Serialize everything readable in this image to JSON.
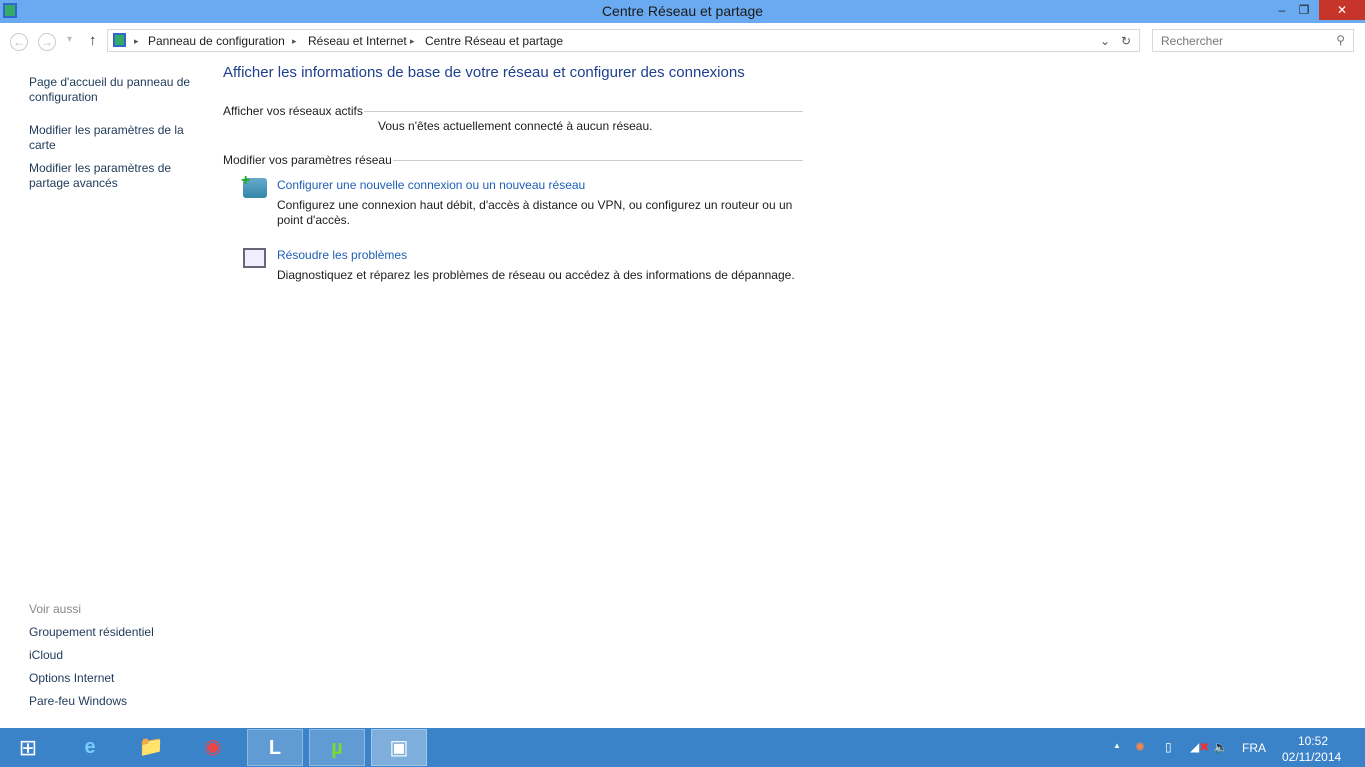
{
  "window": {
    "title": "Centre Réseau et partage",
    "min": "–",
    "restore": "❐",
    "close": "✕"
  },
  "nav": {
    "back": "←",
    "forward": "→",
    "recent": "▾",
    "up": "↑",
    "breadcrumb": [
      "Panneau de configuration",
      "Réseau et Internet",
      "Centre Réseau et partage"
    ],
    "sep": "▸",
    "dropdown": "⌄",
    "refresh": "↻",
    "search_placeholder": "Rechercher",
    "search_icon": "⚲"
  },
  "sidebar": {
    "items": [
      "Page d'accueil du panneau de configuration",
      "Modifier les paramètres de la carte",
      "Modifier les paramètres de partage avancés"
    ],
    "see_also": "Voir aussi",
    "see_also_items": [
      "Groupement résidentiel",
      "iCloud",
      "Options Internet",
      "Pare-feu Windows"
    ]
  },
  "main": {
    "title": "Afficher les informations de base de votre réseau et configurer des connexions",
    "active_networks": "Afficher vos réseaux actifs",
    "not_connected": "Vous n'êtes actuellement connecté à aucun réseau.",
    "modify": "Modifier vos paramètres réseau",
    "tasks": [
      {
        "link": "Configurer une nouvelle connexion ou un nouveau réseau",
        "desc": "Configurez une connexion haut débit, d'accès à distance ou VPN, ou configurez un routeur ou un point d'accès."
      },
      {
        "link": "Résoudre les problèmes",
        "desc": "Diagnostiquez et réparez les problèmes de réseau ou accédez à des informations de dépannage."
      }
    ]
  },
  "taskbar": {
    "apps": [
      "e",
      "📁",
      "◉",
      "L",
      "µ",
      "▣"
    ],
    "tray_arrow": "▲",
    "lang": "FRA",
    "time": "10:52",
    "date": "02/11/2014"
  }
}
